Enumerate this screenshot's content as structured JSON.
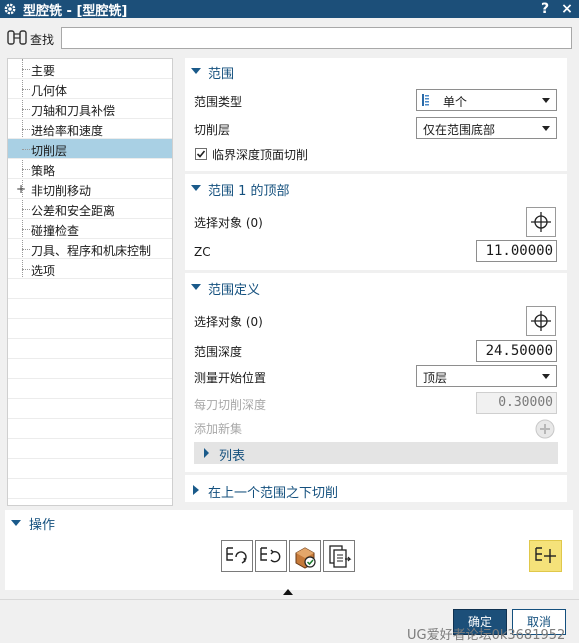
{
  "window": {
    "title": "型腔铣 - [型腔铣]",
    "help_label": "?",
    "close_label": "×"
  },
  "search": {
    "label": "查找",
    "value": ""
  },
  "nav": {
    "items": [
      {
        "label": "主要",
        "selected": false
      },
      {
        "label": "几何体",
        "selected": false
      },
      {
        "label": "刀轴和刀具补偿",
        "selected": false
      },
      {
        "label": "进给率和速度",
        "selected": false
      },
      {
        "label": "切削层",
        "selected": true
      },
      {
        "label": "策略",
        "selected": false
      },
      {
        "label": "非切削移动",
        "selected": false,
        "expandable": true
      },
      {
        "label": "公差和安全距离",
        "selected": false
      },
      {
        "label": "碰撞检查",
        "selected": false
      },
      {
        "label": "刀具、程序和机床控制",
        "selected": false
      },
      {
        "label": "选项",
        "selected": false
      }
    ]
  },
  "range": {
    "header": "范围",
    "range_type_label": "范围类型",
    "range_type_value": "单个",
    "cut_levels_label": "切削层",
    "cut_levels_value": "仅在范围底部",
    "critical_depth_label": "临界深度顶面切削",
    "critical_depth_checked": true
  },
  "range1_top": {
    "header": "范围 1 的顶部",
    "select_object_label": "选择对象 (0)",
    "zc_label": "ZC",
    "zc_value": "11.00000"
  },
  "range_def": {
    "header": "范围定义",
    "select_object_label": "选择对象 (0)",
    "depth_label": "范围深度",
    "depth_value": "24.50000",
    "measure_label": "测量开始位置",
    "measure_value": "顶层",
    "per_cut_label": "每刀切削深度",
    "per_cut_value": "0.30000",
    "add_set_label": "添加新集",
    "list_label": "列表"
  },
  "below_prev": {
    "header": "在上一个范围之下切削"
  },
  "actions": {
    "header": "操作"
  },
  "footer": {
    "ok_label": "确定",
    "cancel_label": "取消",
    "watermark": "UG爱好者论坛0k3681952"
  },
  "colors": {
    "title_bar": "#1c4f79",
    "section_text": "#14507e",
    "selected_row": "#a9d0e4"
  }
}
